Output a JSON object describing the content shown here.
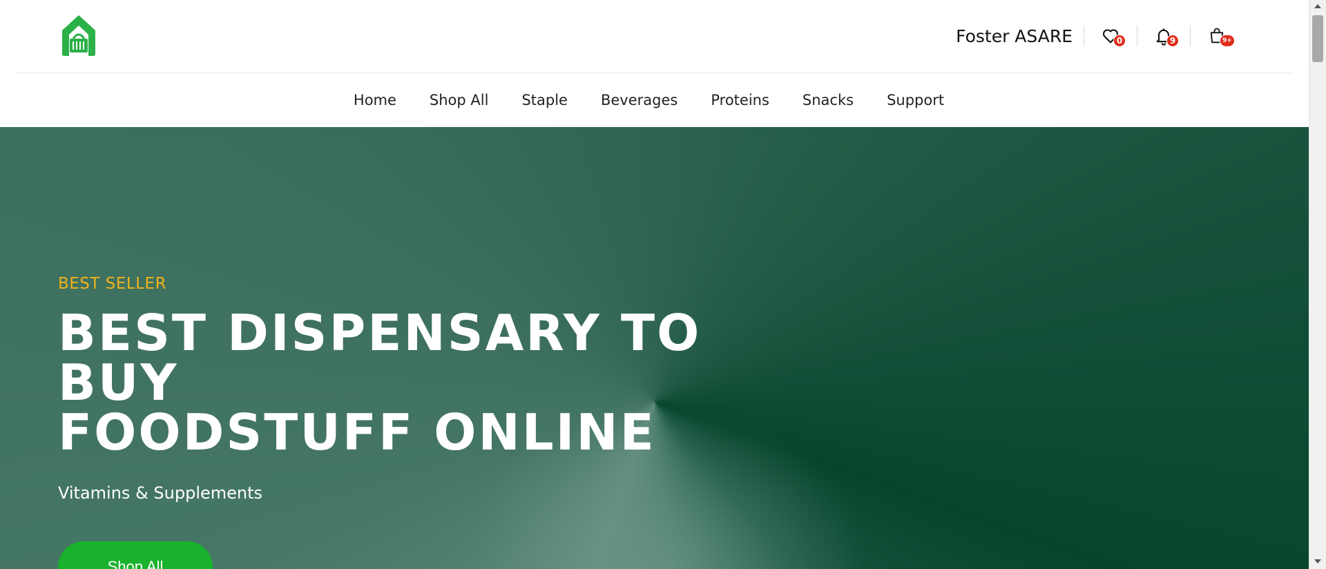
{
  "header": {
    "logo_icon": "house-basket-icon",
    "user_name": "Foster ASARE",
    "wishlist": {
      "icon": "heart-icon",
      "count": "0"
    },
    "notifications": {
      "icon": "bell-icon",
      "count": "9"
    },
    "cart": {
      "icon": "shopping-bag-icon",
      "count": "9+"
    }
  },
  "nav": {
    "items": [
      "Home",
      "Shop All",
      "Staple",
      "Beverages",
      "Proteins",
      "Snacks",
      "Support"
    ]
  },
  "hero": {
    "tag": "BEST SELLER",
    "title_line1": "BEST DISPENSARY TO BUY",
    "title_line2": "FOODSTUFF ONLINE",
    "subtitle": "Vitamins & Supplements",
    "button_label": "Shop All"
  },
  "colors": {
    "brand_green": "#19b22c",
    "hero_dark": "#07452d",
    "accent_yellow": "#efb419",
    "badge_red": "#e02d1b"
  }
}
